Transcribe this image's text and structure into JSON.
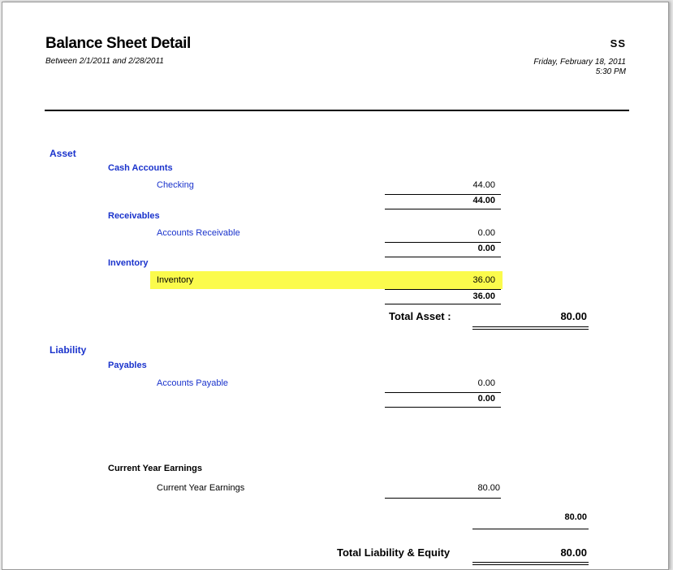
{
  "header": {
    "title": "Balance Sheet Detail",
    "period": "Between 2/1/2011 and 2/28/2011",
    "company": "SS",
    "date": "Friday, February 18, 2011",
    "time": "5:30 PM"
  },
  "asset": {
    "label": "Asset",
    "cash": {
      "label": "Cash Accounts",
      "account": "Checking",
      "amount": "44.00",
      "subtotal": "44.00"
    },
    "receivables": {
      "label": "Receivables",
      "account": "Accounts Receivable",
      "amount": "0.00",
      "subtotal": "0.00"
    },
    "inventory": {
      "label": "Inventory",
      "account": "Inventory",
      "amount": "36.00",
      "subtotal": "36.00"
    },
    "total_label": "Total Asset :",
    "total": "80.00"
  },
  "liability": {
    "label": "Liability",
    "payables": {
      "label": "Payables",
      "account": "Accounts Payable",
      "amount": "0.00",
      "subtotal": "0.00"
    }
  },
  "earnings": {
    "label": "Current Year Earnings",
    "account": "Current Year Earnings",
    "amount": "80.00",
    "subtotal": "80.00"
  },
  "totals": {
    "liability_equity_label": "Total Liability & Equity",
    "liability_equity": "80.00"
  },
  "colors": {
    "section_blue": "#1a33cc",
    "highlight_yellow": "#fbfb4c"
  }
}
